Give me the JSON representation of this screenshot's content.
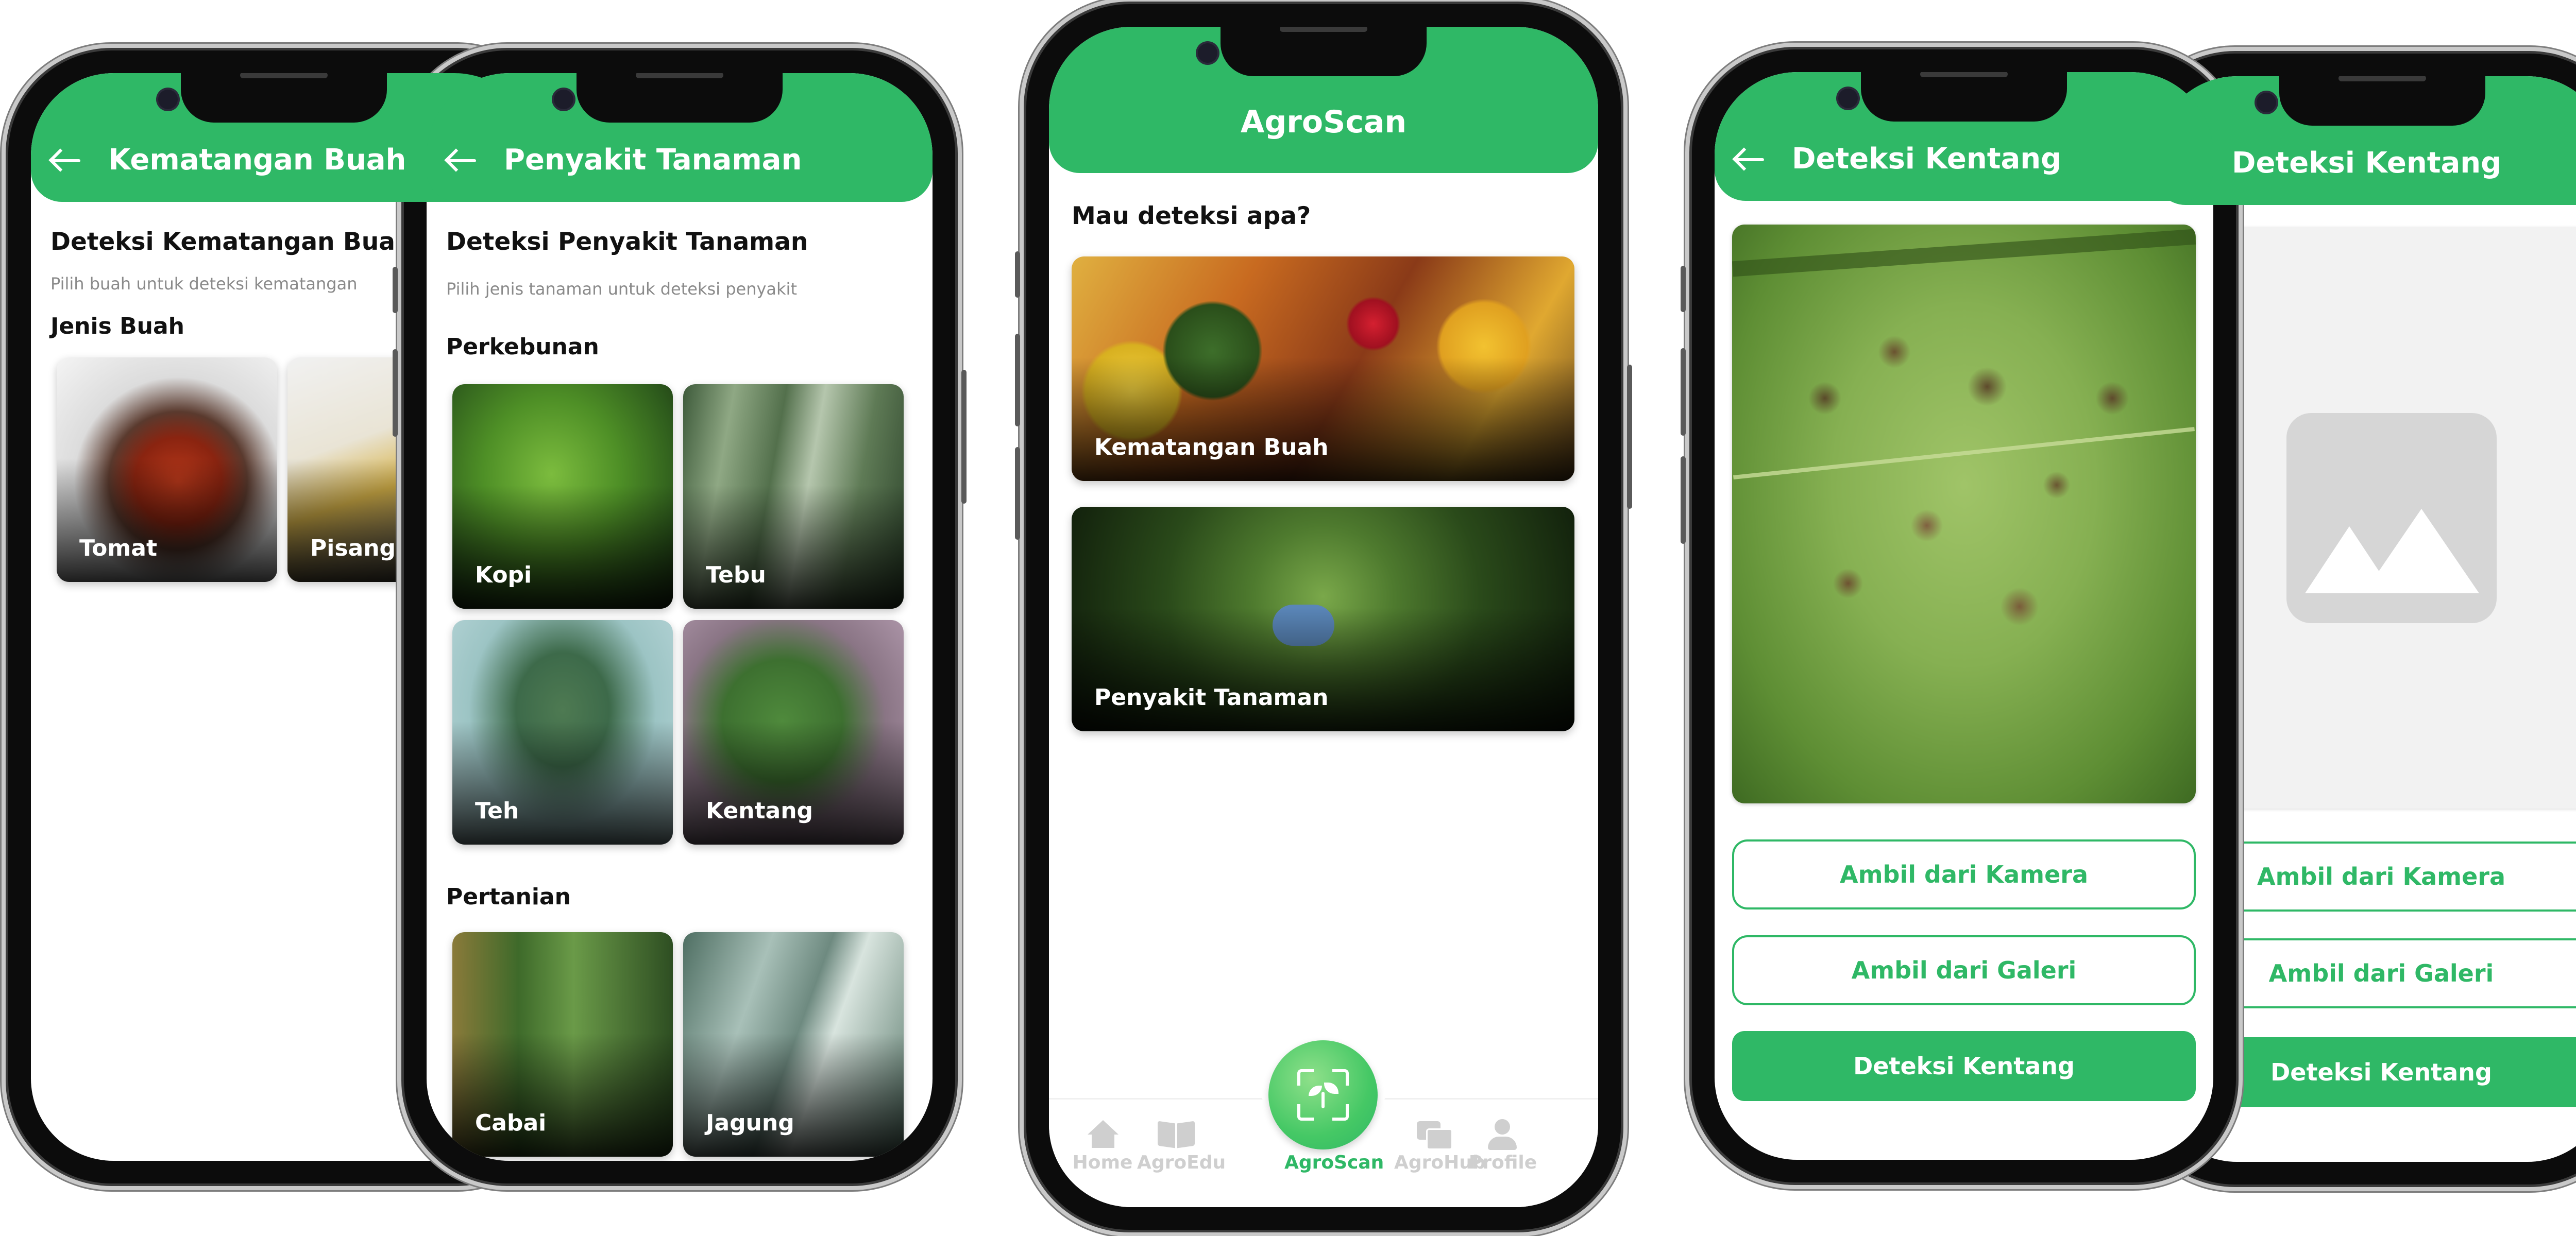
{
  "screens": {
    "fruit": {
      "header_title": "Kematangan Buah",
      "heading": "Deteksi Kematangan Buah",
      "subtitle": "Pilih buah untuk deteksi kematangan",
      "section": "Jenis Buah",
      "cards": [
        "Tomat",
        "Pisang"
      ]
    },
    "disease": {
      "header_title": "Penyakit Tanaman",
      "heading": "Deteksi Penyakit Tanaman",
      "subtitle": "Pilih jenis tanaman untuk deteksi penyakit",
      "sections": [
        {
          "title": "Perkebunan",
          "cards": [
            "Kopi",
            "Tebu",
            "Teh",
            "Kentang"
          ]
        },
        {
          "title": "Pertanian",
          "cards": [
            "Cabai",
            "Jagung"
          ]
        }
      ]
    },
    "agroscan": {
      "header_title": "AgroScan",
      "question": "Mau deteksi apa?",
      "cards": [
        "Kematangan Buah",
        "Penyakit Tanaman"
      ],
      "nav": {
        "items": [
          "Home",
          "AgroEdu",
          "AgroScan",
          "AgroHub",
          "Profile"
        ],
        "active": "AgroScan"
      }
    },
    "potato_result": {
      "header_title": "Deteksi Kentang",
      "buttons": {
        "camera": "Ambil dari Kamera",
        "gallery": "Ambil dari Galeri",
        "detect": "Deteksi Kentang"
      }
    },
    "potato_empty": {
      "header_title": "Deteksi Kentang",
      "buttons": {
        "camera": "Ambil dari Kamera",
        "gallery": "Ambil dari Galeri",
        "detect": "Deteksi Kentang"
      }
    }
  },
  "colors": {
    "primary": "#2fb866",
    "text": "#111111",
    "muted": "#8a8a8a",
    "placeholder": "#d6d6d6"
  },
  "icons": [
    "arrow-left-icon",
    "home-icon",
    "book-icon",
    "scan-leaf-icon",
    "chat-icon",
    "user-icon",
    "image-placeholder-icon"
  ]
}
